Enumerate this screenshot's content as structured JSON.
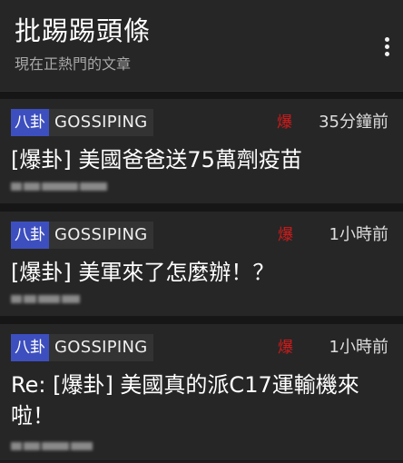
{
  "header": {
    "title": "批踢踢頭條",
    "subtitle": "現在正熱門的文章",
    "more_icon": "more-vertical-icon"
  },
  "posts": [
    {
      "category": "八卦",
      "board": "GOSSIPING",
      "hot_label": "爆",
      "time": "35分鐘前",
      "title": "[爆卦] 美國爸爸送75萬劑疫苗",
      "author_blurred": true
    },
    {
      "category": "八卦",
      "board": "GOSSIPING",
      "hot_label": "爆",
      "time": "1小時前",
      "title": "[爆卦] 美軍來了怎麼辦！？",
      "author_blurred": true
    },
    {
      "category": "八卦",
      "board": "GOSSIPING",
      "hot_label": "爆",
      "time": "1小時前",
      "title": "Re: [爆卦] 美國真的派C17運輸機來啦！",
      "author_blurred": true
    }
  ],
  "colors": {
    "background": "#1d1d1d",
    "card": "#262626",
    "category_badge": "#3d4fbf",
    "hot": "#d21a1a",
    "muted_text": "#a8a8a8"
  }
}
